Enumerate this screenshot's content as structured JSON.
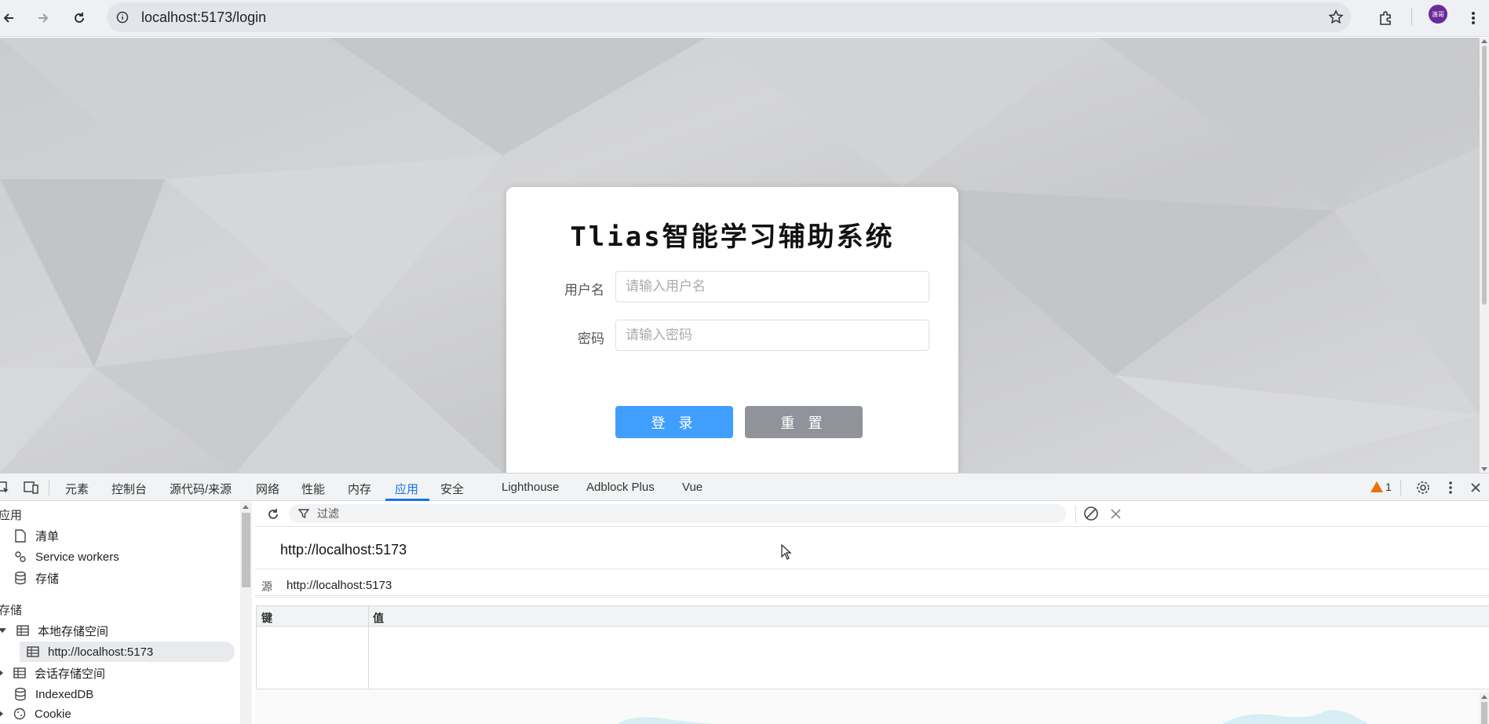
{
  "browser": {
    "url": "localhost:5173/login",
    "avatar_text": "演哥"
  },
  "login": {
    "title": "Tlias智能学习辅助系统",
    "username_label": "用户名",
    "username_placeholder": "请输入用户名",
    "password_label": "密码",
    "password_placeholder": "请输入密码",
    "login_button": "登 录",
    "reset_button": "重 置",
    "colors": {
      "primary": "#409eff",
      "info": "#909399"
    }
  },
  "devtools": {
    "tabs": [
      "元素",
      "控制台",
      "源代码/来源",
      "网络",
      "性能",
      "内存",
      "应用",
      "安全",
      "Lighthouse",
      "Adblock Plus",
      "Vue"
    ],
    "active_tab": "应用",
    "warning_count": "1",
    "sidebar": {
      "section_app": "应用",
      "manifest": "清单",
      "service_workers": "Service workers",
      "storage": "存储",
      "section_storage": "存储",
      "local_storage": "本地存储空间",
      "local_storage_origin": "http://localhost:5173",
      "session_storage": "会话存储空间",
      "indexeddb": "IndexedDB",
      "cookie": "Cookie"
    },
    "main": {
      "filter_placeholder": "过滤",
      "origin_title": "http://localhost:5173",
      "source_label": "源",
      "source_value": "http://localhost:5173",
      "col_key": "键",
      "col_value": "值"
    }
  }
}
